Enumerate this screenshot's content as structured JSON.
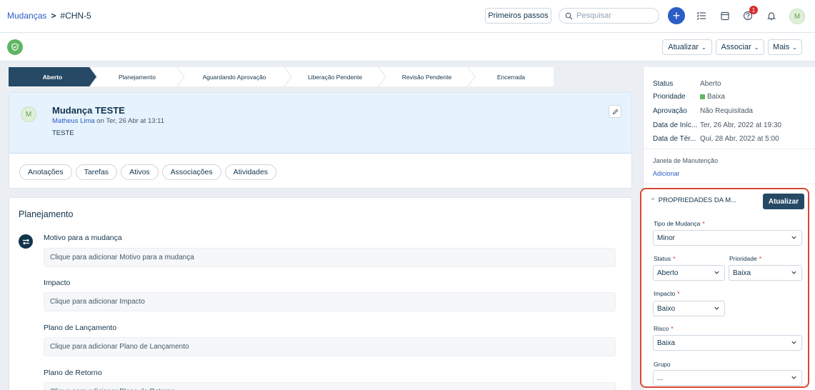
{
  "breadcrumb": {
    "parent": "Mudanças",
    "separator": ">",
    "current": "#CHN-5"
  },
  "topbar": {
    "primeiros_passos": "Primeiros passos",
    "search_placeholder": "Pesquisar",
    "add_symbol": "+",
    "notification_count": "1",
    "user_initial": "M"
  },
  "actions": {
    "atualizar": "Atualizar",
    "associar": "Associar",
    "mais": "Mais"
  },
  "stages": [
    {
      "label": "Aberto",
      "active": true
    },
    {
      "label": "Planejamento",
      "active": false
    },
    {
      "label": "Aguardando Aprovação",
      "active": false
    },
    {
      "label": "Liberação Pendente",
      "active": false
    },
    {
      "label": "Revisão Pendente",
      "active": false
    },
    {
      "label": "Encerrada",
      "active": false
    }
  ],
  "ticket": {
    "avatar_initial": "M",
    "title": "Mudança TESTE",
    "author": "Matheus Lima",
    "meta_on": " on Ter, 26 Abr at 13:11",
    "description": "TESTE"
  },
  "tabs": [
    "Anotações",
    "Tarefas",
    "Ativos",
    "Associações",
    "Atividades"
  ],
  "planning": {
    "title": "Planejamento",
    "fields": [
      {
        "label": "Motivo para a mudança",
        "placeholder": "Clique para adicionar Motivo para a mudança"
      },
      {
        "label": "Impacto",
        "placeholder": "Clique para adicionar Impacto"
      },
      {
        "label": "Plano de Lançamento",
        "placeholder": "Clique para adicionar Plano de Lançamento"
      },
      {
        "label": "Plano de Retorno",
        "placeholder": "Clique para adicionar Plano de Retorno"
      }
    ]
  },
  "summary": {
    "status_k": "Status",
    "status_v": "Aberto",
    "prioridade_k": "Prioridade",
    "prioridade_v": "Baixa",
    "aprovacao_k": "Aprovação",
    "aprovacao_v": "Não Requisitada",
    "inicio_k": "Data de Iníc...",
    "inicio_v": "Ter, 26 Abr, 2022 at 19:30",
    "termino_k": "Data de Tér...",
    "termino_v": "Qui, 28 Abr, 2022 at 5:00",
    "janela_label": "Janela de Manutenção",
    "janela_link": "Adicionar",
    "priority_color": "#5fb563"
  },
  "properties": {
    "header": "PROPRIEDADES DA M...",
    "update_button": "Atualizar",
    "tipo_label": "Tipo de Mudança",
    "tipo_value": "Minor",
    "status_label": "Status",
    "status_value": "Aberto",
    "prioridade_label": "Prioridade",
    "prioridade_value": "Baixa",
    "impacto_label": "Impacto",
    "impacto_value": "Baixo",
    "risco_label": "Risco",
    "risco_value": "Baixa",
    "grupo_label": "Grupo",
    "grupo_value": "...",
    "required_mark": "*",
    "highlight_color": "#d94734"
  }
}
